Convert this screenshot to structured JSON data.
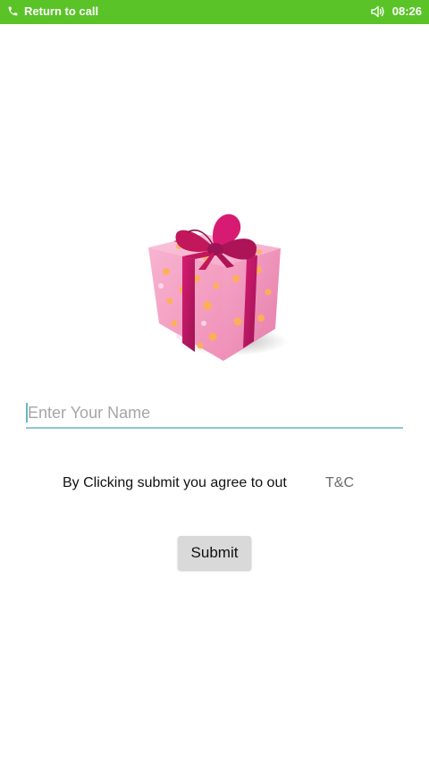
{
  "status_bar": {
    "call_label": "Return to call",
    "time": "08:26",
    "background": "#5ac328",
    "left_icon": "phone-icon",
    "right_icon": "speaker-icon"
  },
  "gift": {
    "icon": "gift-box-icon",
    "box_color": "#f4a6c8",
    "ribbon_color": "#c2185b"
  },
  "form": {
    "name_placeholder": "Enter Your Name",
    "name_value": "",
    "agree_text": "By Clicking submit you agree to out",
    "tc_link": "T&C",
    "submit_label": "Submit"
  }
}
